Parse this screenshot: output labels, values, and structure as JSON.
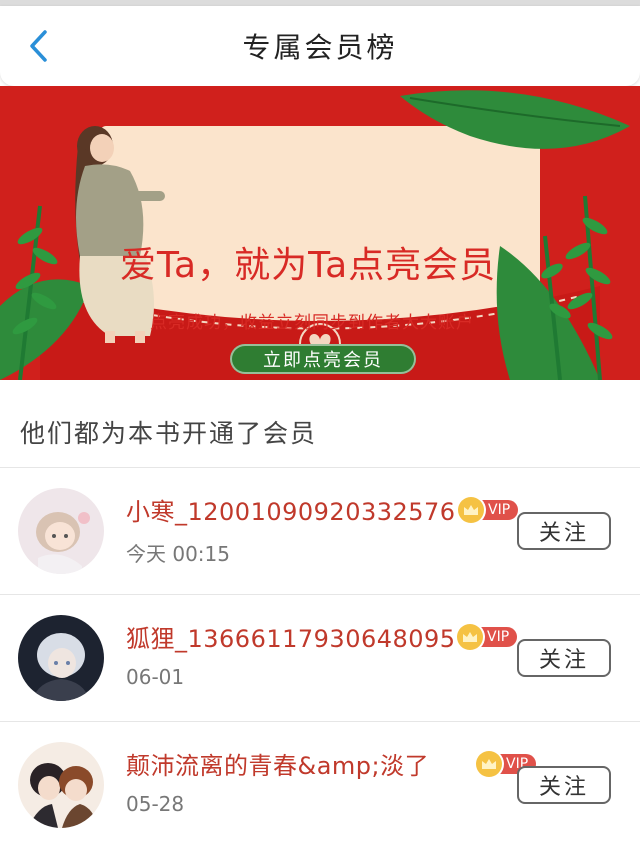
{
  "header": {
    "title": "专属会员榜",
    "back_icon": "back-chevron-icon"
  },
  "banner": {
    "headline": "爱Ta，就为Ta点亮会员",
    "subtitle": "点亮成功，收益立刻同步到作者大大账户",
    "cta_label": "立即点亮会员",
    "colors": {
      "background": "#d0201c",
      "card": "#fbe4cc",
      "leaf": "#2e8b3b",
      "cta": "#2f7d32"
    }
  },
  "section": {
    "title": "他们都为本书开通了会员"
  },
  "members": [
    {
      "name": "小寒_12001090920332576",
      "date": "今天 00:15",
      "badge": "VIP",
      "follow_label": "关注"
    },
    {
      "name": "狐狸_13666117930648095",
      "date": "06-01",
      "badge": "VIP",
      "follow_label": "关注"
    },
    {
      "name": "颠沛流离的青春&amp;淡了",
      "date": "05-28",
      "badge": "VIP",
      "follow_label": "关注"
    }
  ]
}
